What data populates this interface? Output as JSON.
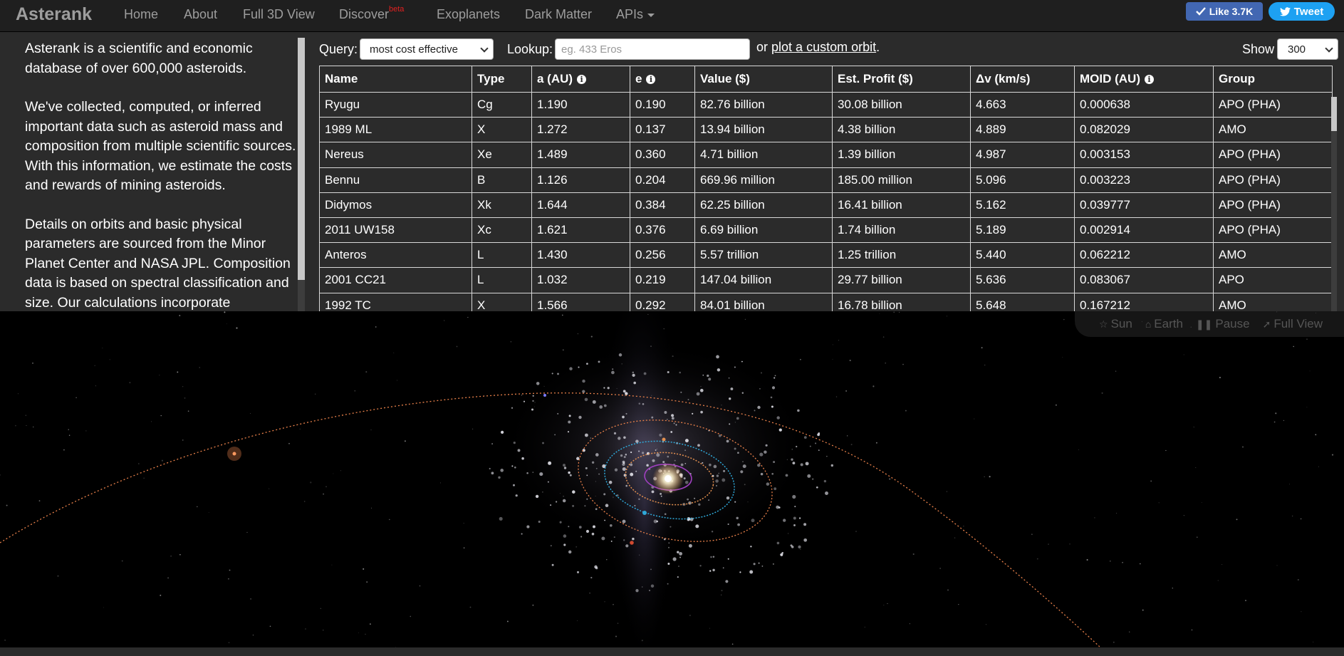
{
  "nav": {
    "brand": "Asterank",
    "items": [
      "Home",
      "About",
      "Full 3D View",
      "Discover",
      "Exoplanets",
      "Dark Matter",
      "APIs"
    ],
    "discover_badge": "beta",
    "like_label": "Like 3.7K",
    "tweet_label": "Tweet"
  },
  "intro": {
    "paragraphs": [
      "Asterank is a scientific and economic database of over 600,000 asteroids.",
      "We've collected, computed, or inferred important data such as asteroid mass and composition from multiple scientific sources. With this information, we estimate the costs and rewards of mining asteroids.",
      "Details on orbits and basic physical parameters are sourced from the Minor Planet Center and NASA JPL. Composition data is based on spectral classification and size. Our calculations incorporate"
    ]
  },
  "controls": {
    "query_label": "Query:",
    "query_value": "most cost effective",
    "lookup_label": "Lookup:",
    "lookup_placeholder": "eg. 433 Eros",
    "or_text": "or",
    "custom_orbit_link": "plot a custom orbit",
    "period": ".",
    "show_label": "Show",
    "show_value": "300"
  },
  "table": {
    "headers": [
      "Name",
      "Type",
      "a (AU)",
      "e",
      "Value ($)",
      "Est. Profit ($)",
      "Δv (km/s)",
      "MOID (AU)",
      "Group"
    ],
    "rows": [
      [
        "Ryugu",
        "Cg",
        "1.190",
        "0.190",
        "82.76 billion",
        "30.08 billion",
        "4.663",
        "0.000638",
        "APO (PHA)"
      ],
      [
        "1989 ML",
        "X",
        "1.272",
        "0.137",
        "13.94 billion",
        "4.38 billion",
        "4.889",
        "0.082029",
        "AMO"
      ],
      [
        "Nereus",
        "Xe",
        "1.489",
        "0.360",
        "4.71 billion",
        "1.39 billion",
        "4.987",
        "0.003153",
        "APO (PHA)"
      ],
      [
        "Bennu",
        "B",
        "1.126",
        "0.204",
        "669.96 million",
        "185.00 million",
        "5.096",
        "0.003223",
        "APO (PHA)"
      ],
      [
        "Didymos",
        "Xk",
        "1.644",
        "0.384",
        "62.25 billion",
        "16.41 billion",
        "5.162",
        "0.039777",
        "APO (PHA)"
      ],
      [
        "2011 UW158",
        "Xc",
        "1.621",
        "0.376",
        "6.69 billion",
        "1.74 billion",
        "5.189",
        "0.002914",
        "APO (PHA)"
      ],
      [
        "Anteros",
        "L",
        "1.430",
        "0.256",
        "5.57 trillion",
        "1.25 trillion",
        "5.440",
        "0.062212",
        "AMO"
      ],
      [
        "2001 CC21",
        "L",
        "1.032",
        "0.219",
        "147.04 billion",
        "29.77 billion",
        "5.636",
        "0.083067",
        "APO"
      ],
      [
        "1992 TC",
        "X",
        "1.566",
        "0.292",
        "84.01 billion",
        "16.78 billion",
        "5.648",
        "0.167212",
        "AMO"
      ]
    ]
  },
  "view3d": {
    "buttons": [
      "Sun",
      "Earth",
      "Pause",
      "Full View"
    ],
    "icons": [
      "star-icon",
      "home-icon",
      "pause-icon",
      "arrow-icon"
    ],
    "orbit_colors": {
      "comet": "#e8804a",
      "mercury": "#a040c0",
      "venus": "#e39050",
      "earth": "#2fa8d8",
      "mars": "#d04a30"
    }
  }
}
